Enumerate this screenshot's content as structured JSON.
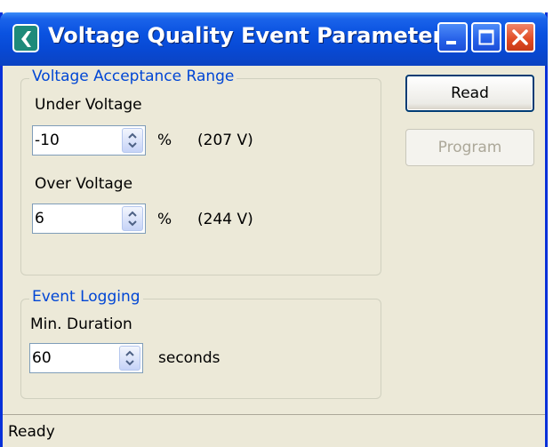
{
  "window": {
    "title": "Voltage Quality Event Parameters"
  },
  "voltage_range": {
    "legend": "Voltage Acceptance Range",
    "under": {
      "label": "Under Voltage",
      "value": "-10",
      "unit": "%",
      "equivalent": "(207 V)"
    },
    "over": {
      "label": "Over Voltage",
      "value": "6",
      "unit": "%",
      "equivalent": "(244 V)"
    }
  },
  "event_logging": {
    "legend": "Event Logging",
    "min_duration": {
      "label": "Min. Duration",
      "value": "60",
      "unit": "seconds"
    }
  },
  "buttons": {
    "read": "Read",
    "program": "Program"
  },
  "status": {
    "text": "Ready"
  },
  "colors": {
    "titlebar": "#0a52e0",
    "group_legend": "#0046d5",
    "window_bg": "#ece9d8",
    "disabled_text": "#aca899"
  }
}
